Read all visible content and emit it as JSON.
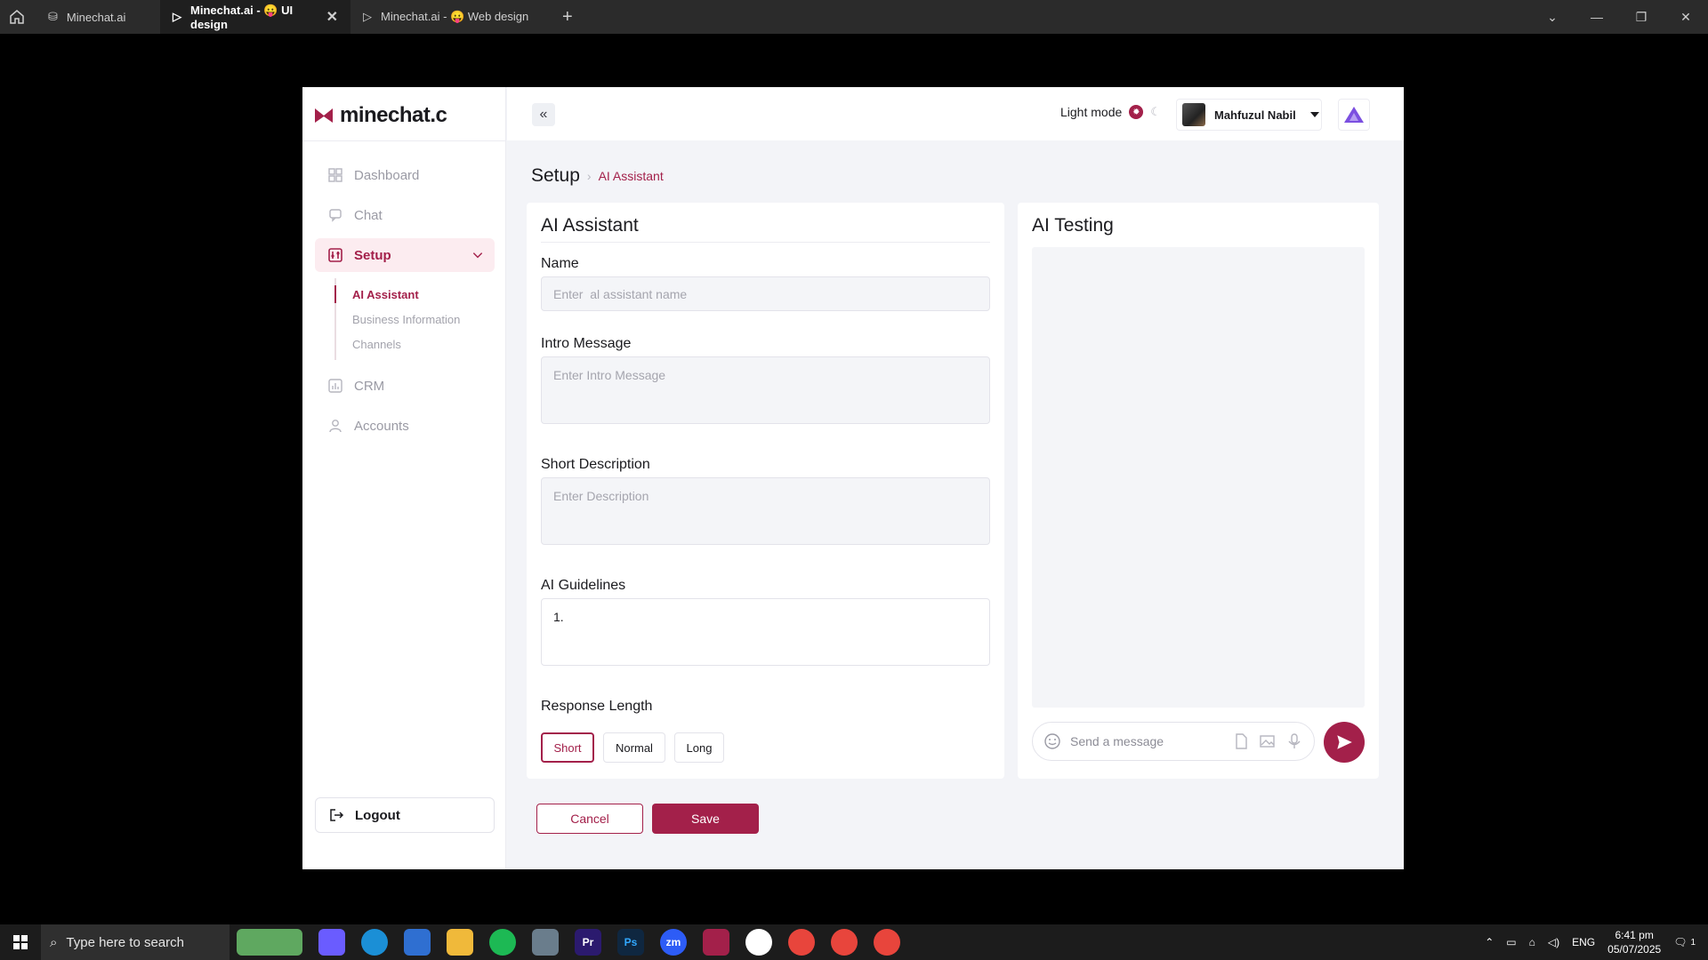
{
  "browser": {
    "tabs": [
      {
        "label": "Minechat.ai"
      },
      {
        "label": "Minechat.ai - 😛 UI design"
      },
      {
        "label": "Minechat.ai - 😛 Web design"
      }
    ]
  },
  "app": {
    "logo_text": "minechat.c",
    "nav": {
      "dashboard": "Dashboard",
      "chat": "Chat",
      "setup": "Setup",
      "sub": [
        "AI Assistant",
        "Business Information",
        "Channels"
      ],
      "crm": "CRM",
      "accounts": "Accounts",
      "logout": "Logout"
    },
    "topbar": {
      "mode_label": "Light mode",
      "user_name": "Mahfuzul Nabil"
    },
    "breadcrumb": {
      "root": "Setup",
      "current": "AI Assistant"
    },
    "form": {
      "title": "AI Assistant",
      "name_label": "Name",
      "name_placeholder": "Enter  al assistant name",
      "intro_label": "Intro Message",
      "intro_placeholder": "Enter Intro Message",
      "desc_label": "Short Description",
      "desc_placeholder": "Enter Description",
      "guidelines_label": "AI Guidelines",
      "guidelines_value": "1.",
      "response_label": "Response Length",
      "response_options": [
        "Short",
        "Normal",
        "Long"
      ],
      "response_selected": "Short"
    },
    "testing": {
      "title": "AI Testing",
      "message_placeholder": "Send a message"
    },
    "actions": {
      "cancel": "Cancel",
      "save": "Save"
    },
    "colors": {
      "accent": "#a3204a",
      "brand_purple": "#7b4fe0"
    }
  },
  "taskbar": {
    "search_placeholder": "Type here to search",
    "language": "ENG",
    "time": "6:41 pm",
    "date": "05/07/2025",
    "notification_count": "1"
  }
}
